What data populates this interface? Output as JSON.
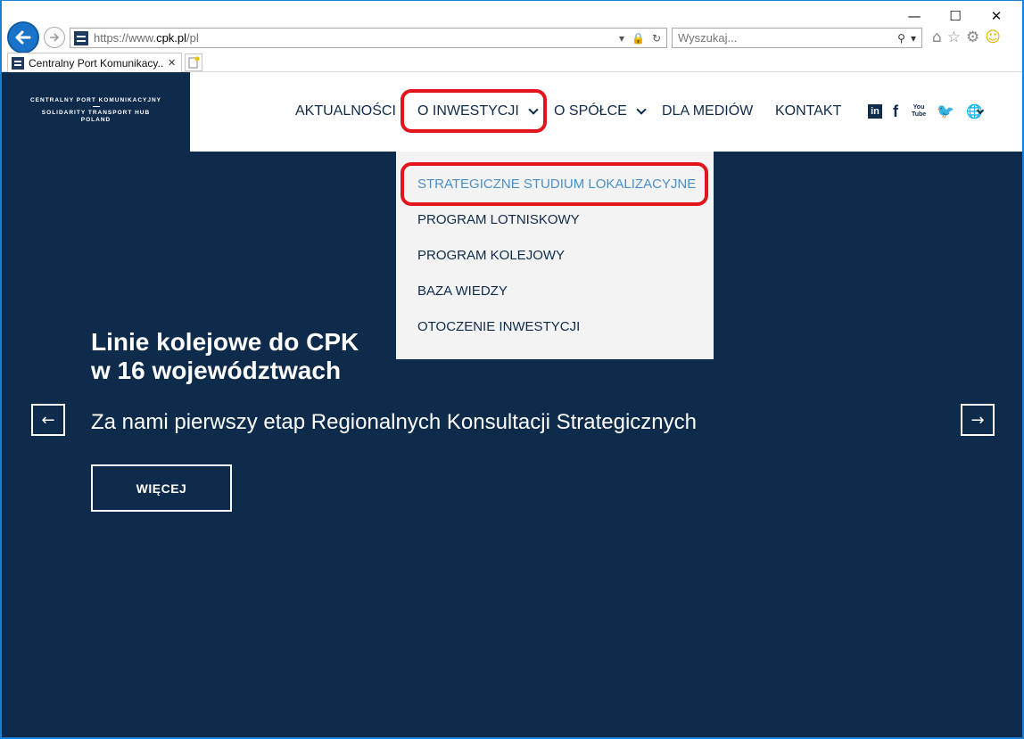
{
  "browser": {
    "window_controls": {
      "minimize": "—",
      "maximize": "☐",
      "close": "✕"
    },
    "address": {
      "prefix": "https://www.",
      "host": "cpk.pl",
      "path": "/pl"
    },
    "search": {
      "placeholder": "Wyszukaj..."
    },
    "tab": {
      "title": "Centralny Port Komunikacy...",
      "close": "✕"
    },
    "icons": [
      "home-icon",
      "star-icon",
      "gear-icon",
      "smiley-icon"
    ]
  },
  "site": {
    "logo": {
      "line1": "CENTRALNY PORT KOMUNIKACYJNY",
      "line2": "SOLIDARITY TRANSPORT HUB",
      "line3": "POLAND"
    },
    "menu": {
      "news": "AKTUALNOŚCI",
      "investment": "O INWESTYCJI",
      "company": "O SPÓŁCE",
      "media": "DLA MEDIÓW",
      "contact": "KONTAKT"
    },
    "social": {
      "linkedin": "in",
      "facebook": "f",
      "youtube": "You Tube",
      "twitter": "🐦",
      "globe": "🌐"
    },
    "dropdown": [
      "STRATEGICZNE STUDIUM LOKALIZACYJNE",
      "PROGRAM LOTNISKOWY",
      "PROGRAM KOLEJOWY",
      "BAZA WIEDZY",
      "OTOCZENIE INWESTYCJI"
    ],
    "hero": {
      "title_line1": "Linie kolejowe do CPK",
      "title_line2": "w 16 województwach",
      "subtitle": "Za nami pierwszy etap Regionalnych Konsultacji Strategicznych",
      "button": "WIĘCEJ",
      "prev": "←",
      "next": "→"
    }
  },
  "colors": {
    "navy": "#0f2b4b",
    "highlight": "#e3141b",
    "active_link": "#4b8fc7",
    "dropdown_bg": "#f3f3f3"
  }
}
